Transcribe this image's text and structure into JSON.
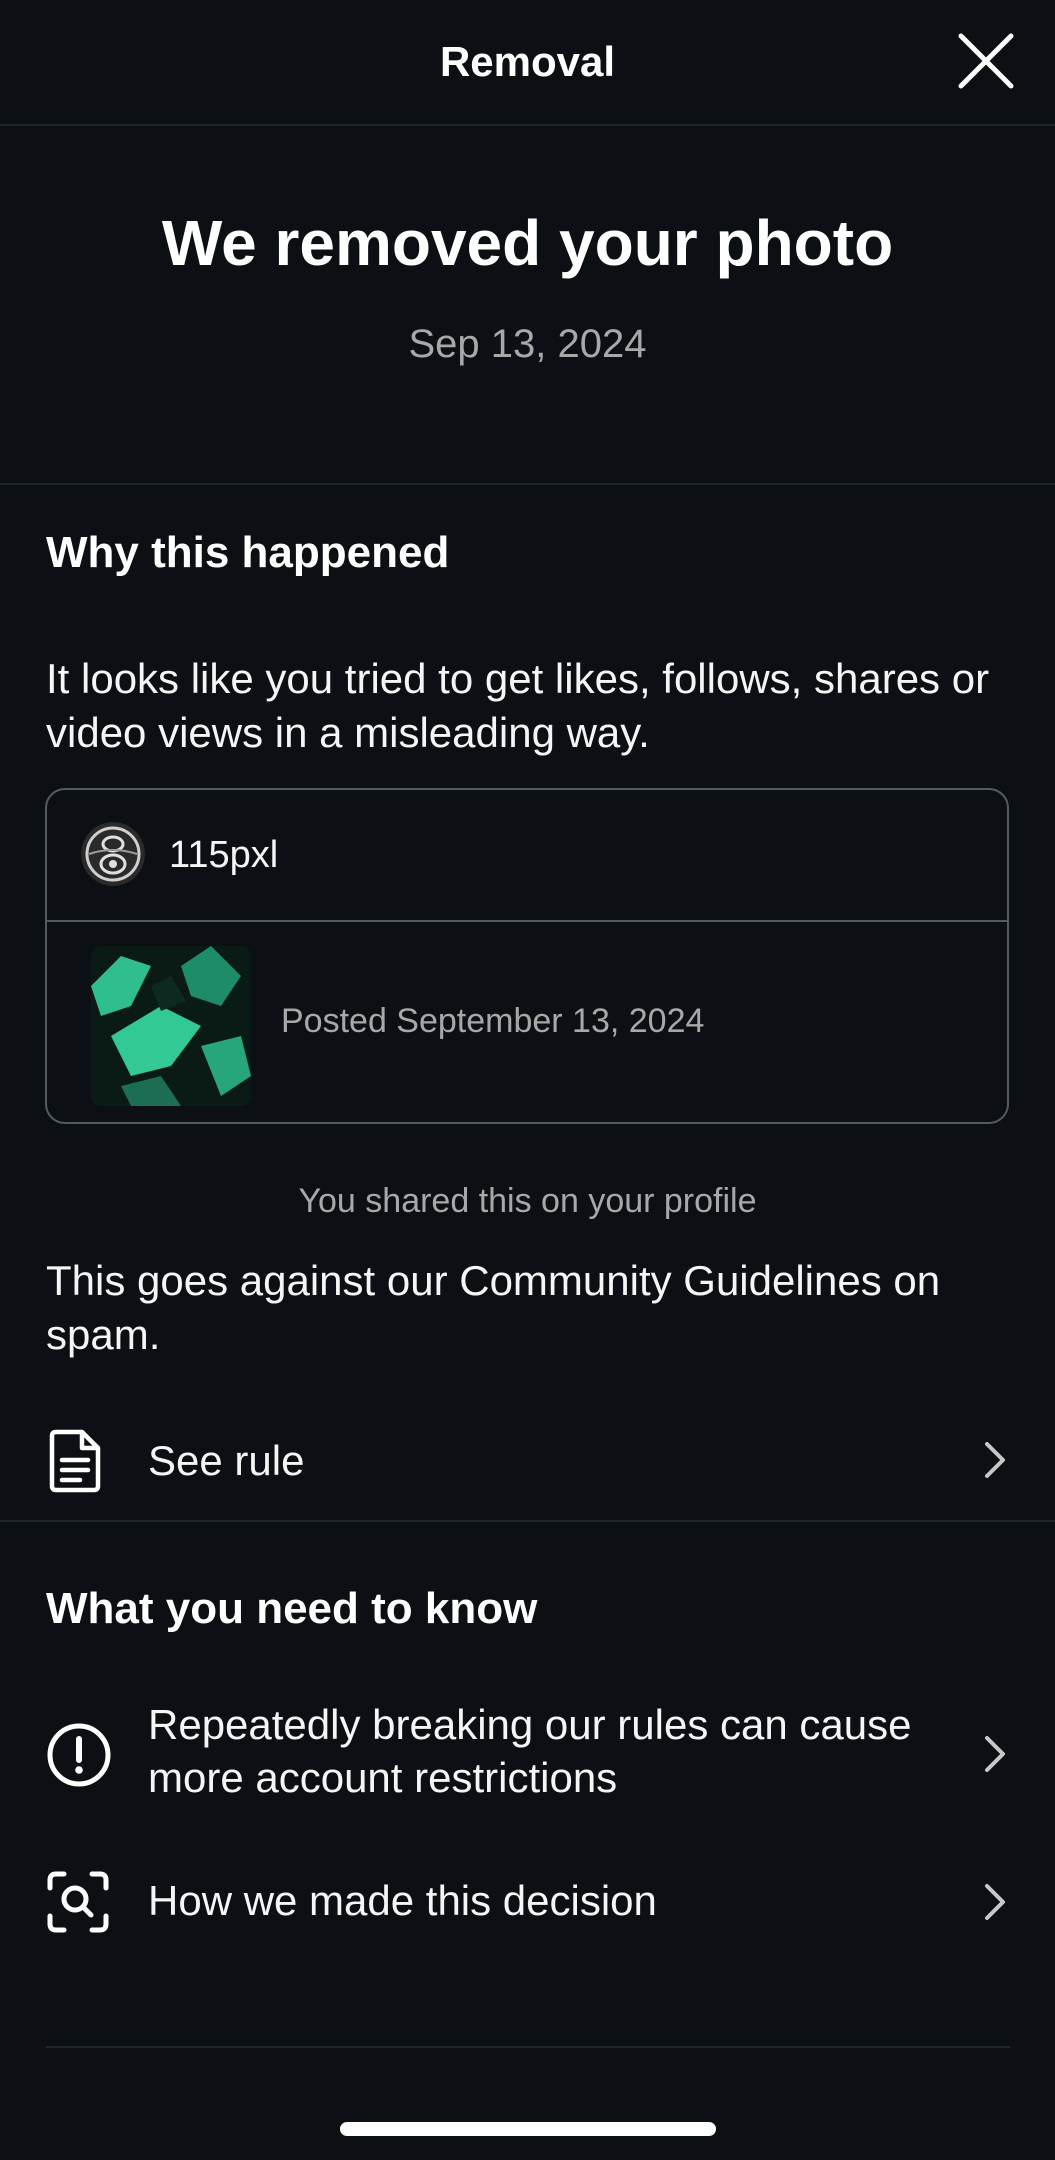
{
  "header": {
    "title": "Removal"
  },
  "hero": {
    "title": "We removed your photo",
    "date": "Sep 13, 2024"
  },
  "why": {
    "heading": "Why this happened",
    "explanation": "It looks like you tried to get likes, follows, shares or video views in a misleading way."
  },
  "post_card": {
    "username": "115pxl",
    "posted_text": "Posted September 13, 2024"
  },
  "shared_caption": "You shared this on your profile",
  "guideline_text": "This goes against our Community Guidelines on spam.",
  "see_rule": {
    "label": "See rule",
    "icon": "document-icon"
  },
  "need_to_know": {
    "heading": "What you need to know",
    "items": [
      {
        "label": "Repeatedly breaking our rules can cause more account restrictions",
        "icon": "exclamation-circle-icon"
      },
      {
        "label": "How we made this decision",
        "icon": "scan-search-icon"
      }
    ]
  },
  "colors": {
    "background": "#0c1014",
    "primary_text": "#f5f5f5",
    "secondary_text": "#a8a8a8",
    "border": "#565b60",
    "thumbnail_accent": "#2fbf8f"
  }
}
